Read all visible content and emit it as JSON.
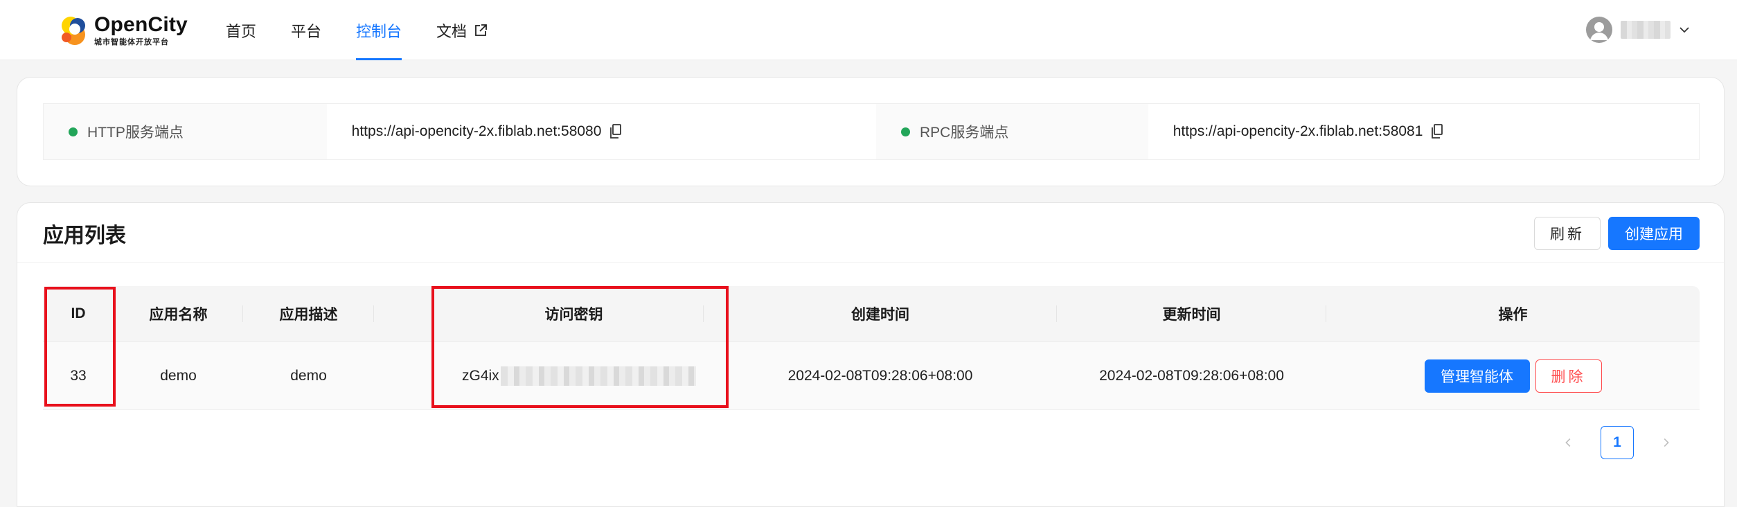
{
  "brand": {
    "name": "OpenCity",
    "tagline": "城市智能体开放平台"
  },
  "nav": {
    "items": [
      {
        "label": "首页",
        "active": false
      },
      {
        "label": "平台",
        "active": false
      },
      {
        "label": "控制台",
        "active": true
      },
      {
        "label": "文档",
        "active": false,
        "external": true
      }
    ]
  },
  "user": {
    "name": "",
    "name_obscured": true,
    "avatar_icon": "user-icon"
  },
  "endpoints": [
    {
      "label": "HTTP服务端点",
      "url": "https://api-opencity-2x.fiblab.net:58080",
      "status_color": "#22a559"
    },
    {
      "label": "RPC服务端点",
      "url": "https://api-opencity-2x.fiblab.net:58081",
      "status_color": "#22a559"
    }
  ],
  "app_list": {
    "title": "应用列表",
    "refresh_label": "刷新",
    "create_label": "创建应用",
    "columns": {
      "id": "ID",
      "name": "应用名称",
      "desc": "应用描述",
      "key": "访问密钥",
      "created": "创建时间",
      "updated": "更新时间",
      "ops": "操作"
    },
    "rows": [
      {
        "id": "33",
        "name": "demo",
        "desc": "demo",
        "key_prefix": "zG4ix",
        "key_obscured": true,
        "created": "2024-02-08T09:28:06+08:00",
        "updated": "2024-02-08T09:28:06+08:00",
        "manage_label": "管理智能体",
        "delete_label": "删除"
      }
    ]
  },
  "pagination": {
    "current_page": "1",
    "prev_icon": "chevron-left-icon",
    "next_icon": "chevron-right-icon"
  },
  "colors": {
    "accent": "#1677ff",
    "danger": "#ff4d4f",
    "status_ok": "#22a559",
    "highlight": "#e8101c"
  }
}
